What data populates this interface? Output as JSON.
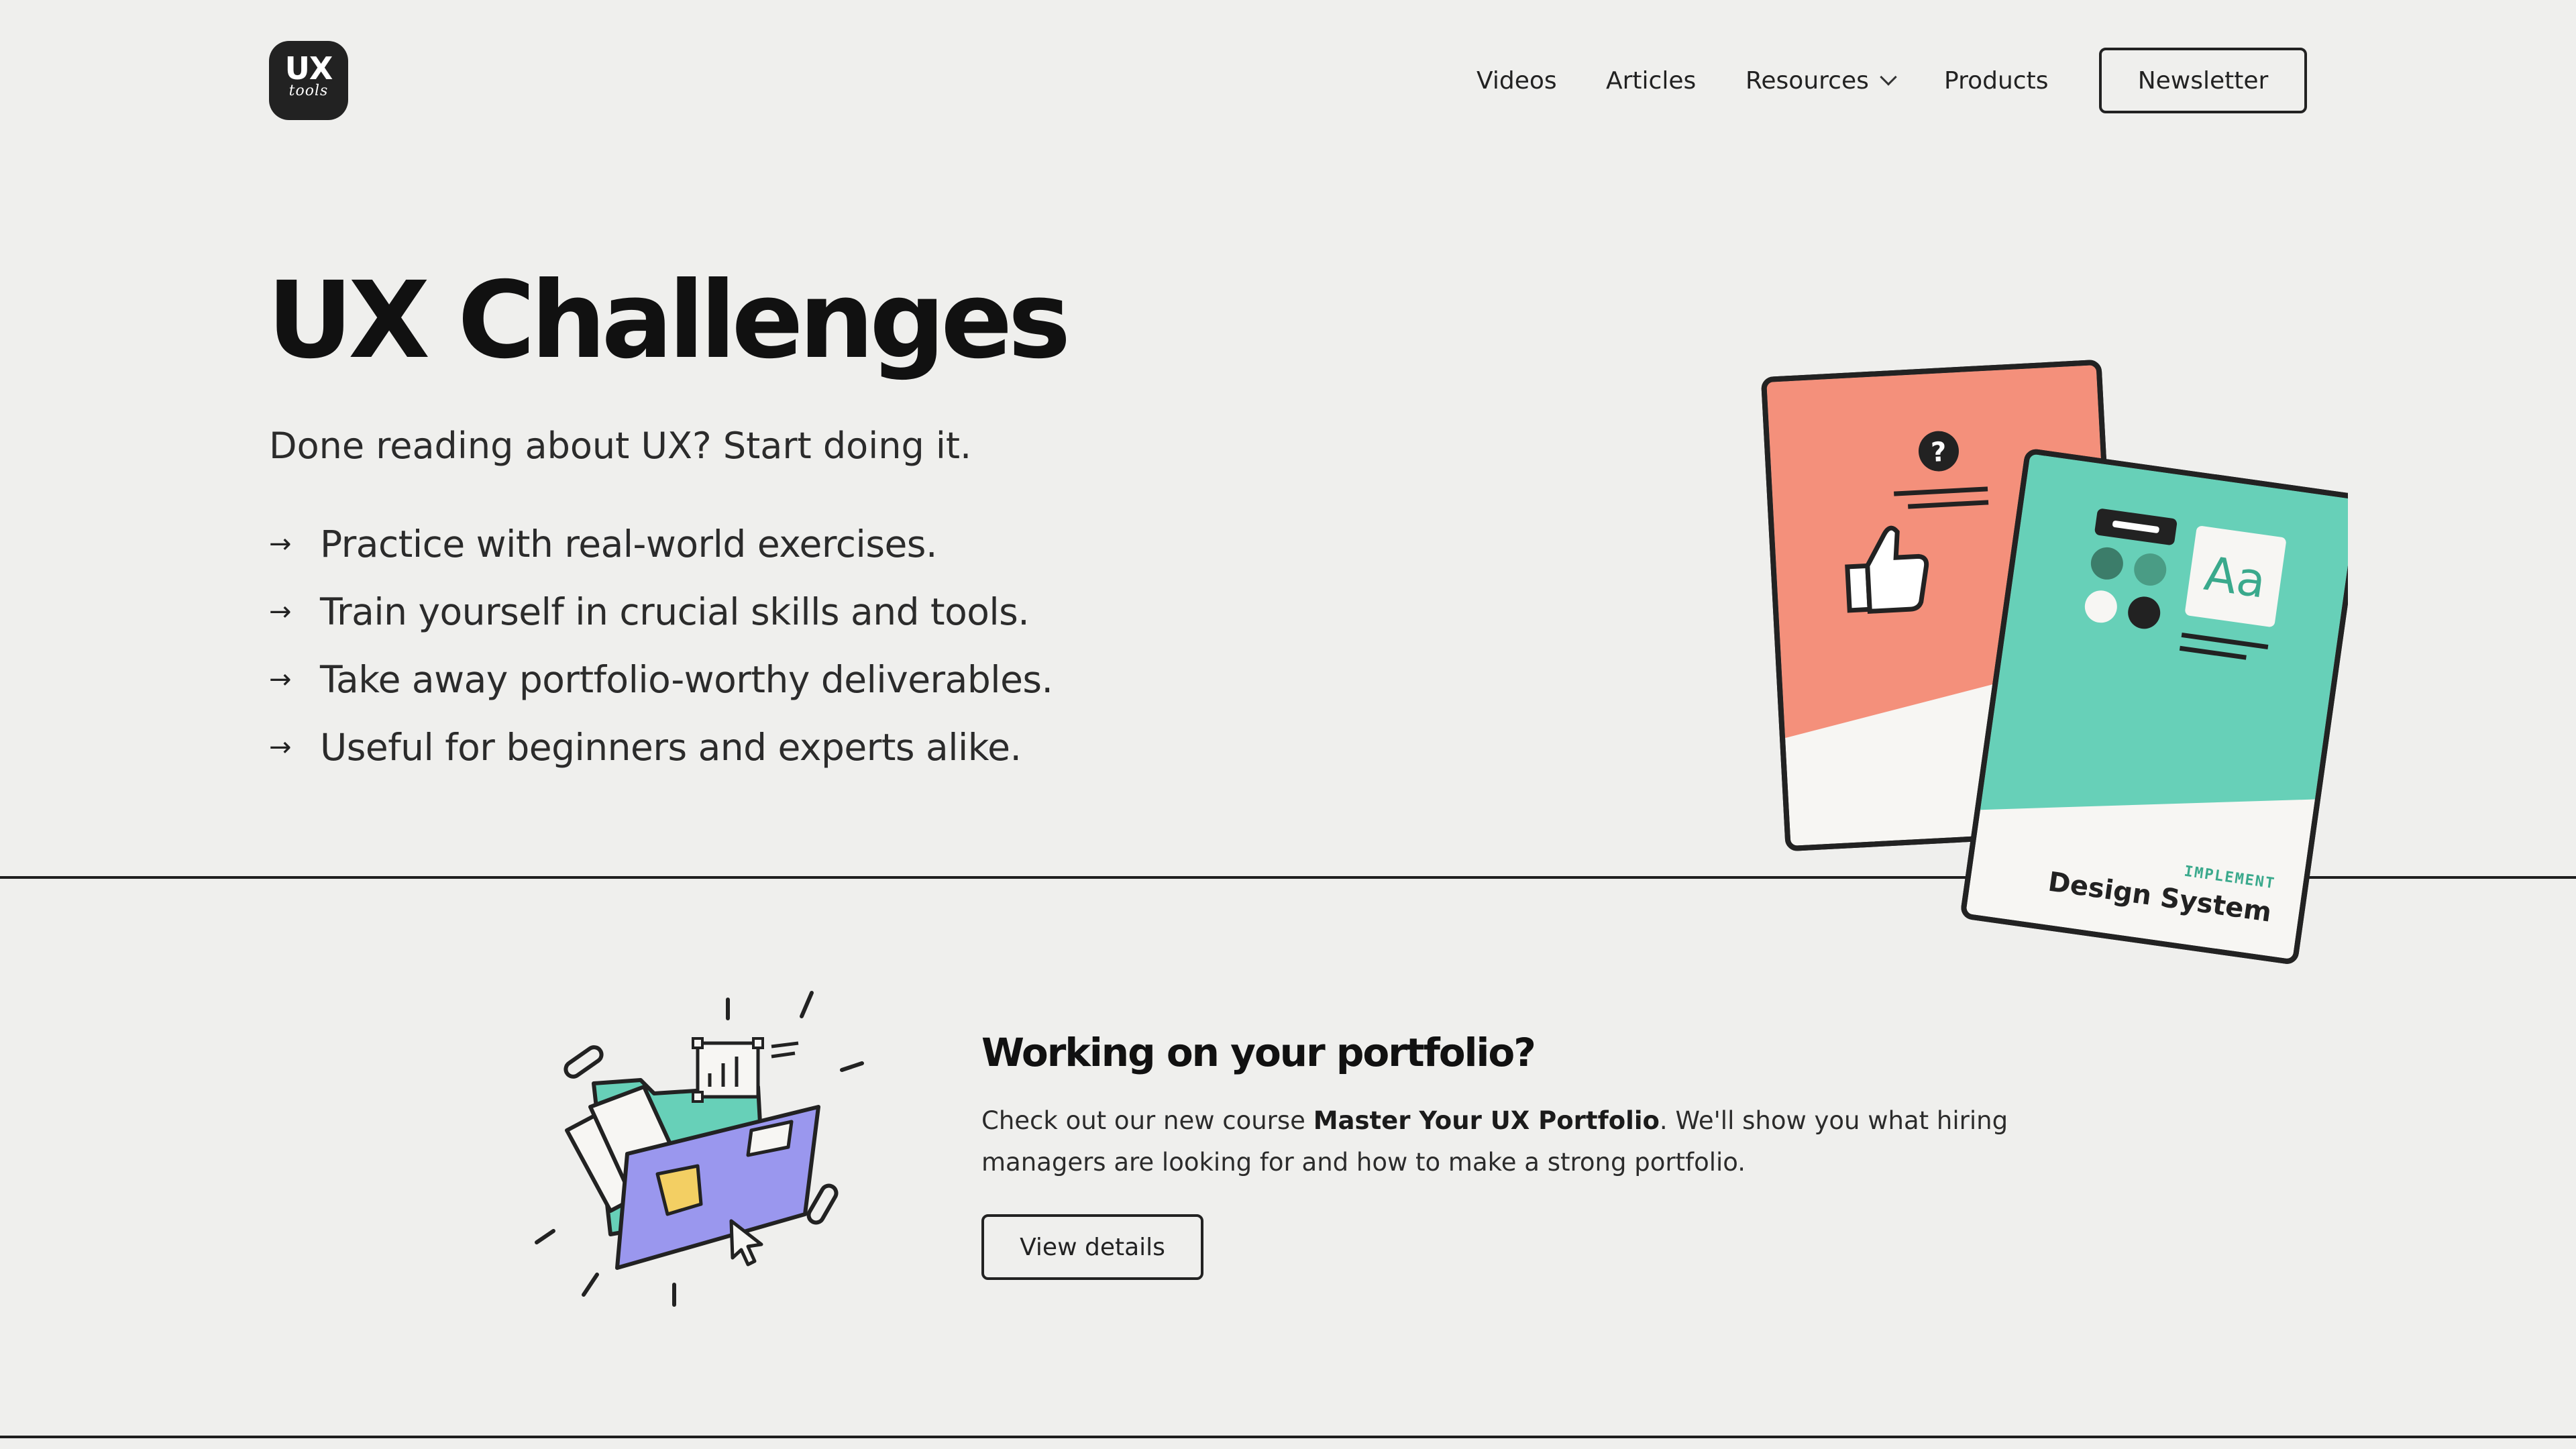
{
  "header": {
    "logo": {
      "line1": "UX",
      "line2": "tools"
    },
    "nav": [
      {
        "label": "Videos"
      },
      {
        "label": "Articles"
      },
      {
        "label": "Resources",
        "has_dropdown": true
      },
      {
        "label": "Products"
      }
    ],
    "newsletter_label": "Newsletter"
  },
  "hero": {
    "title": "UX Challenges",
    "subtitle": "Done reading about UX? Start doing it.",
    "bullet_icon": "arrow-right-icon",
    "bullets": [
      "Practice with real-world exercises.",
      "Train yourself in crucial skills and tools.",
      "Take away portfolio-worthy deliverables.",
      "Useful for beginners and experts alike."
    ],
    "cards": {
      "front_tag": "IMPLEMENT",
      "front_title": "Design System",
      "front_specimen": "Aa",
      "back_icons": [
        "question-icon",
        "thumbs-up-icon"
      ]
    }
  },
  "promo": {
    "title": "Working on your portfolio?",
    "body_prefix": "Check out our new course ",
    "body_bold": "Master Your UX Portfolio",
    "body_suffix": ". We'll show you what hiring managers are looking for and how to make a strong portfolio.",
    "button_label": "View details"
  },
  "colors": {
    "background": "#efefed",
    "ink": "#1b1b1b",
    "card_coral": "#f4907b",
    "card_teal": "#67d0b8",
    "folder_purple": "#9a97ee",
    "note_yellow": "#f3cf63"
  }
}
